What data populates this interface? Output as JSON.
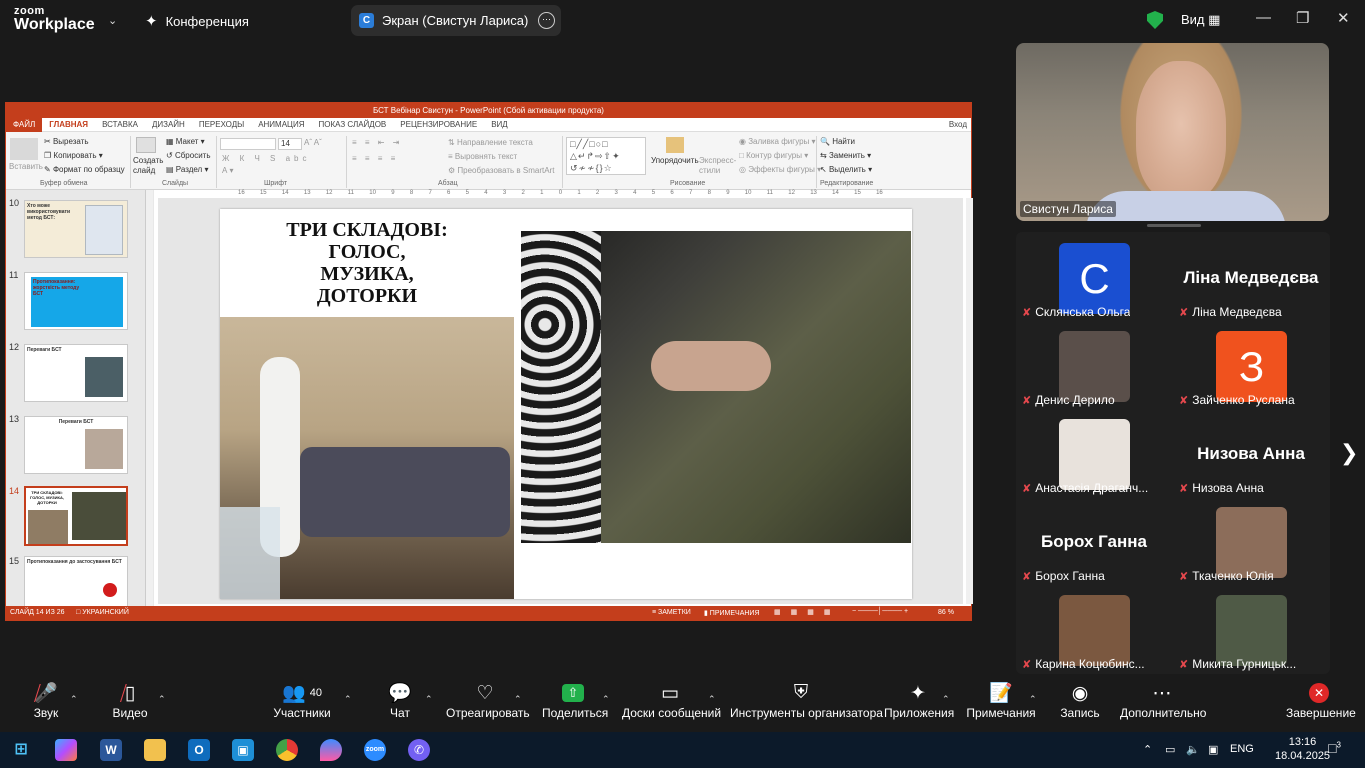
{
  "zoom": {
    "logo_top": "zoom",
    "logo_bottom": "Workplace",
    "meeting_label": "Конференция",
    "share_label": "Экран (Свистун Лариса)",
    "view_label": "Вид"
  },
  "ppt": {
    "window_title": "БСТ Вебінар Свистун - PowerPoint (Сбой активации продукта)",
    "tabs": [
      "ФАЙЛ",
      "ГЛАВНАЯ",
      "ВСТАВКА",
      "ДИЗАЙН",
      "ПЕРЕХОДЫ",
      "АНИМАЦИЯ",
      "ПОКАЗ СЛАЙДОВ",
      "РЕЦЕНЗИРОВАНИЕ",
      "ВИД"
    ],
    "signin": "Вход",
    "ribbon": {
      "paste": "Вставить",
      "cut": "Вырезать",
      "copy": "Копировать",
      "format_painter": "Формат по образцу",
      "clipboard_group": "Буфер обмена",
      "new_slide": "Создать слайд",
      "layout": "Макет",
      "reset": "Сбросить",
      "section": "Раздел",
      "slides_group": "Слайды",
      "font_size": "14",
      "font_group": "Шрифт",
      "text_direction": "Направление текста",
      "align_text": "Выровнять текст",
      "smartart": "Преобразовать в SmartArt",
      "paragraph_group": "Абзац",
      "arrange": "Упорядочить",
      "quick_styles": "Экспресс-стили",
      "shape_fill": "Заливка фигуры",
      "shape_outline": "Контур фигуры",
      "shape_effects": "Эффекты фигуры",
      "drawing_group": "Рисование",
      "find": "Найти",
      "replace": "Заменить",
      "select": "Выделить",
      "editing_group": "Редактирование"
    },
    "ruler": [
      "16",
      "15",
      "14",
      "13",
      "12",
      "11",
      "10",
      "9",
      "8",
      "7",
      "6",
      "5",
      "4",
      "3",
      "2",
      "1",
      "0",
      "1",
      "2",
      "3",
      "4",
      "5",
      "6",
      "7",
      "8",
      "9",
      "10",
      "11",
      "12",
      "13",
      "14",
      "15",
      "16"
    ],
    "thumbs": [
      {
        "num": "10",
        "title": "Хто може використовувати метод БСТ:"
      },
      {
        "num": "11",
        "title": "Протипоказання: жорсткість методу БСТ"
      },
      {
        "num": "12",
        "title": "Переваги БСТ"
      },
      {
        "num": "13",
        "title": "Переваги БСТ"
      },
      {
        "num": "14",
        "title": "ТРИ СКЛАДОВІ: ГОЛОС, МУЗИКА, ДОТОРКИ"
      },
      {
        "num": "15",
        "title": "Протипоказання до застосування БСТ"
      }
    ],
    "slide_title": [
      "ТРИ СКЛАДОВІ:",
      "ГОЛОС,",
      "МУЗИКА,",
      "ДОТОРКИ"
    ],
    "status_slide": "СЛАЙД 14 ИЗ 26",
    "status_lang": "УКРАИНСКИЙ",
    "status_notes": "ЗАМЕТКИ",
    "status_comments": "ПРИМЕЧАНИЯ",
    "zoom_level": "86 %"
  },
  "speaker": {
    "name": "Свистун Лариса"
  },
  "participants": [
    {
      "name": "Склянська Ольга",
      "type": "letter",
      "letter": "C",
      "color": "#1a4fd1"
    },
    {
      "name": "Ліна Медведєва",
      "type": "name",
      "big": "Ліна Медведєва"
    },
    {
      "name": "Денис Дерило",
      "type": "photo",
      "color": "#5a4f4a"
    },
    {
      "name": "Зайченко Руслана",
      "type": "letter",
      "letter": "З",
      "color": "#f0521e"
    },
    {
      "name": "Анастасія Драганч...",
      "type": "photo",
      "color": "#e8e2dc"
    },
    {
      "name": "Низова Анна",
      "type": "name",
      "big": "Низова Анна"
    },
    {
      "name": "Борох Ганна",
      "type": "name",
      "big": "Борох Ганна"
    },
    {
      "name": "Ткаченко Юлія",
      "type": "photo",
      "color": "#8c6d5a"
    },
    {
      "name": "Карина Коцюбинс...",
      "type": "photo",
      "color": "#7b5840"
    },
    {
      "name": "Микита Гурницьк...",
      "type": "photo",
      "color": "#4f5a46"
    }
  ],
  "toolbar": {
    "audio": "Звук",
    "video": "Видео",
    "participants": "Участники",
    "participants_count": "40",
    "chat": "Чат",
    "react": "Отреагировать",
    "share": "Поделиться",
    "whiteboards": "Доски сообщений",
    "host_tools": "Инструменты организатора",
    "apps": "Приложения",
    "notes": "Примечания",
    "record": "Запись",
    "more": "Дополнительно",
    "end": "Завершение"
  },
  "taskbar": {
    "lang": "ENG",
    "time": "13:16",
    "date": "18.04.2025",
    "notifications": "3"
  },
  "colors": {
    "ppt_accent": "#c43e1c",
    "share_green": "#22b14c",
    "end_red": "#e02828",
    "zoom_blue": "#2d8cff"
  }
}
